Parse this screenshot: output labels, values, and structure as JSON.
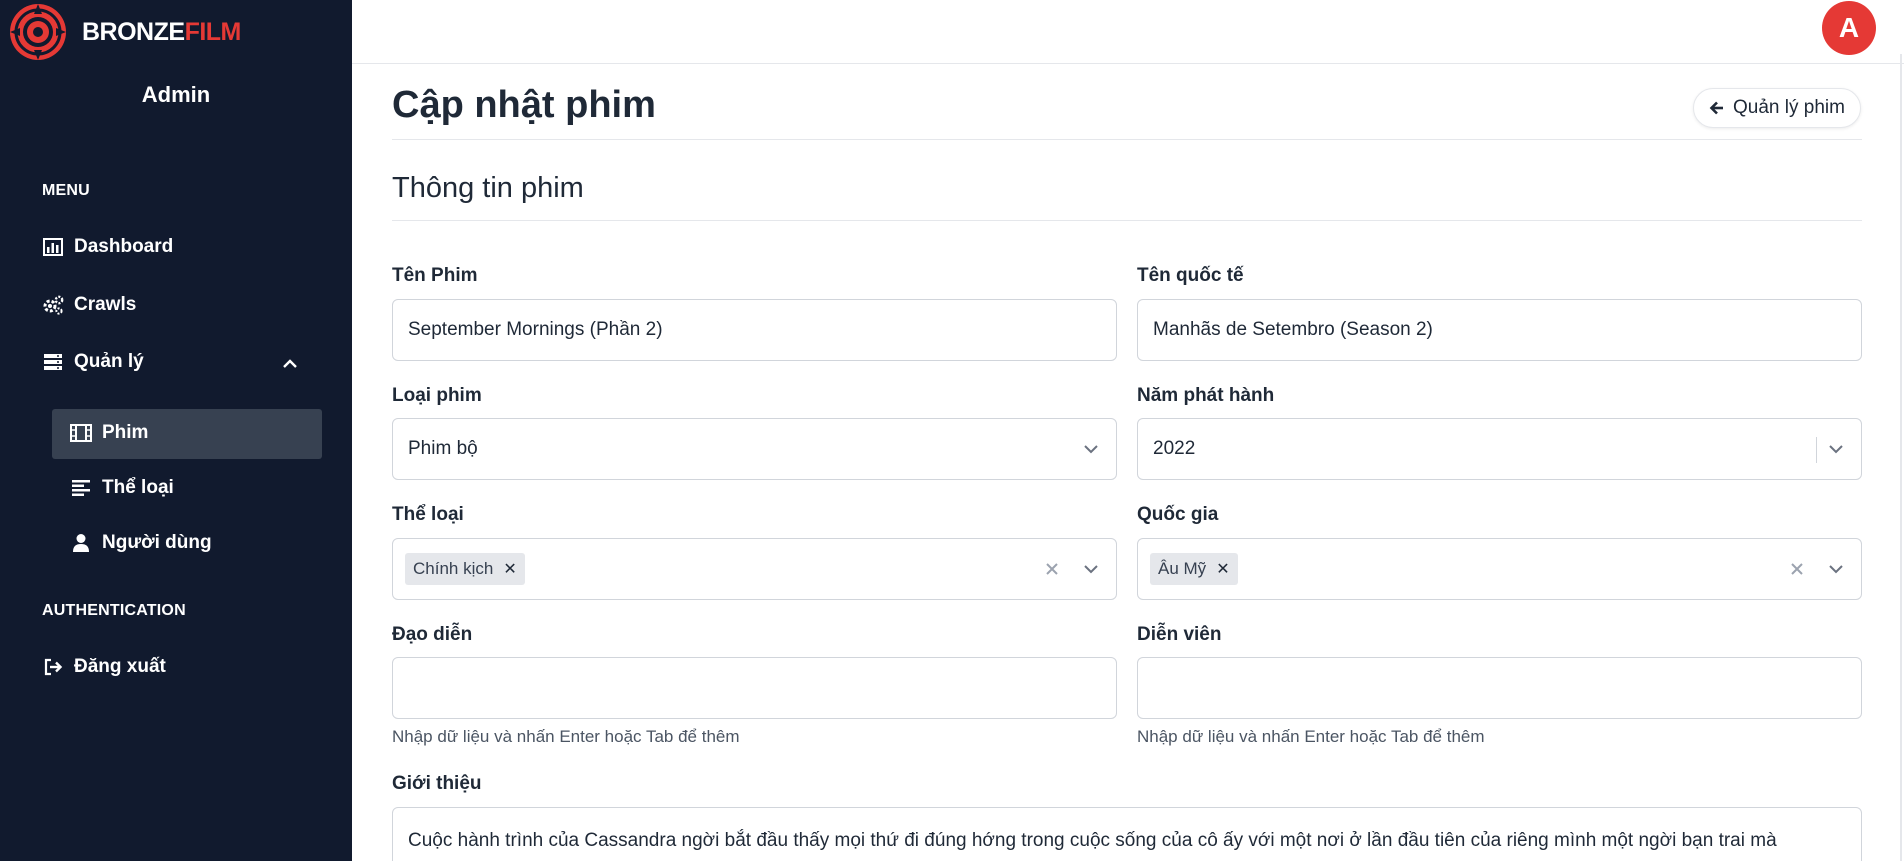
{
  "brand": {
    "part1": "BRONZE",
    "part2": "FILM"
  },
  "sidebar": {
    "admin_name": "Admin",
    "menu_label": "MENU",
    "auth_label": "AUTHENTICATION",
    "items": {
      "dashboard": "Dashboard",
      "crawls": "Crawls",
      "manage": "Quản lý",
      "films": "Phim",
      "genres": "Thể loại",
      "users": "Người dùng",
      "logout": "Đăng xuất"
    }
  },
  "header": {
    "avatar_letter": "A"
  },
  "page": {
    "title": "Cập nhật phim",
    "back_button": "Quản lý phim",
    "section_title": "Thông tin phim"
  },
  "form": {
    "name": {
      "label": "Tên Phim",
      "value": "September Mornings (Phần 2)"
    },
    "intl_name": {
      "label": "Tên quốc tế",
      "value": "Manhãs de Setembro (Season 2)"
    },
    "type": {
      "label": "Loại phim",
      "value": "Phim bộ"
    },
    "year": {
      "label": "Năm phát hành",
      "value": "2022"
    },
    "genre": {
      "label": "Thể loại",
      "tags": [
        "Chính kịch"
      ]
    },
    "country": {
      "label": "Quốc gia",
      "tags": [
        "Âu Mỹ"
      ]
    },
    "director": {
      "label": "Đạo diễn",
      "value": "",
      "hint": "Nhập dữ liệu và nhấn Enter hoặc Tab để thêm"
    },
    "actors": {
      "label": "Diễn viên",
      "value": "",
      "hint": "Nhập dữ liệu và nhấn Enter hoặc Tab để thêm"
    },
    "intro": {
      "label": "Giới thiệu",
      "value": "Cuộc hành trình của Cassandra ngời bắt đầu thấy mọi thứ đi đúng hớng trong cuộc sống của cô ấy với một nơi ở lần đầu tiên của riêng mình một ngời bạn trai mà"
    }
  },
  "colors": {
    "sidebar_bg": "#111a2e",
    "accent": "#e53935",
    "active_bg": "#374151"
  }
}
